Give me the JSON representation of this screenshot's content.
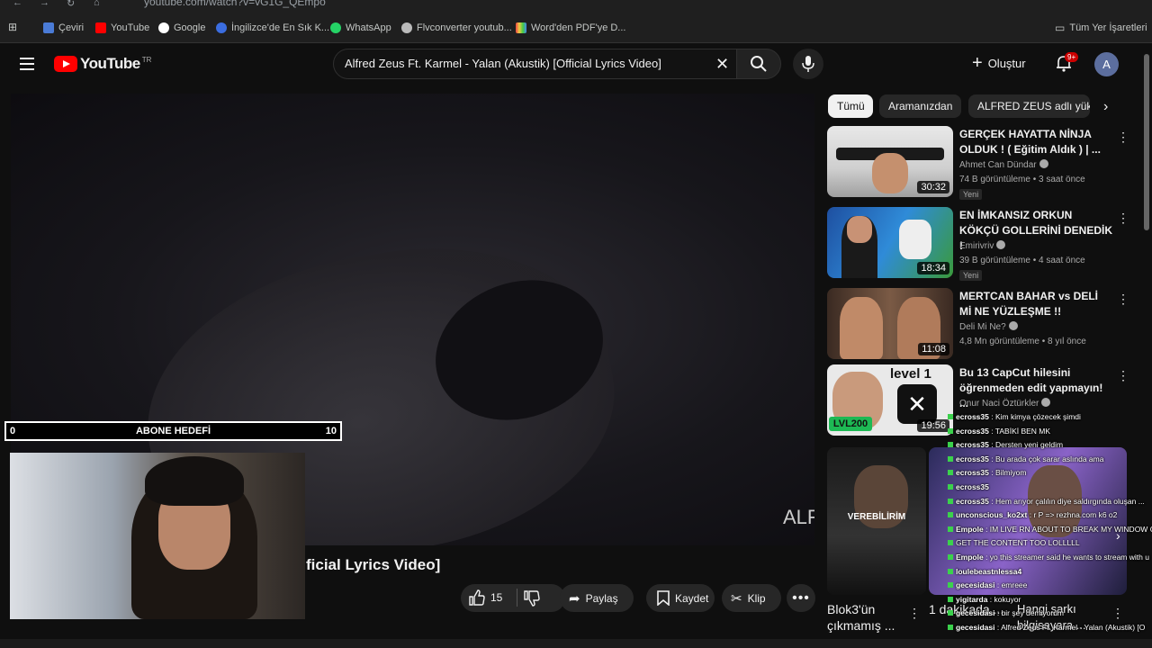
{
  "browser": {
    "url": "youtube.com/watch?v=vG1G_QEmpo",
    "bookmarks": [
      "Çeviri",
      "YouTube",
      "Google",
      "İngilizce'de En Sık K...",
      "WhatsApp",
      "Flvconverter youtub...",
      "Word'den PDF'ye D..."
    ],
    "all_bookmarks": "Tüm Yer İşaretleri"
  },
  "header": {
    "logo": "YouTube",
    "region": "TR",
    "search_value": "Alfred Zeus Ft. Karmel - Yalan (Akustik) [Official Lyrics Video]",
    "create_label": "Oluştur",
    "notifications_badge": "9+",
    "avatar_letter": "A"
  },
  "player": {
    "watermark": "ALF",
    "goal": {
      "min": "0",
      "label": "ABONE HEDEFİ",
      "max": "10"
    },
    "title_visible": "ficial Lyrics Video]"
  },
  "actions": {
    "like_count": "15",
    "share": "Paylaş",
    "save": "Kaydet",
    "clip": "Klip"
  },
  "chips": [
    "Tümü",
    "Aramanızdan",
    "ALFRED ZEUS adlı yükl"
  ],
  "suggestions": [
    {
      "title": "GERÇEK HAYATTA NİNJA OLDUK ! ( Eğitim Aldık ) | ...",
      "channel": "Ahmet Can Dündar",
      "meta": "74 B görüntüleme • 3 saat önce",
      "badge": "Yeni",
      "duration": "30:32"
    },
    {
      "title": "EN İMKANSIZ ORKUN KÖKÇÜ GOLLERİNİ DENEDİK !",
      "channel": "Emirivriv",
      "meta": "39 B görüntüleme • 4 saat önce",
      "badge": "Yeni",
      "duration": "18:34"
    },
    {
      "title": "MERTCAN BAHAR vs DELİ Mİ NE YÜZLEŞME !!",
      "channel": "Deli Mi Ne?",
      "meta": "4,8 Mn görüntüleme • 8 yıl önce",
      "badge": "",
      "duration": "11:08"
    },
    {
      "title": "Bu 13 CapCut hilesini öğrenmeden edit yapmayın! ...",
      "channel": "Onur Naci Öztürkler",
      "meta": "",
      "badge": "",
      "duration": "19:56"
    }
  ],
  "shorts": [
    {
      "title": "Blok3'ün çıkmamış ...",
      "overlay": "VEREBİLİRİM"
    },
    {
      "title": "1 dakikada ...",
      "overlay": ""
    }
  ],
  "shorts_extra": "Hangi şarkı bilgisayara ...",
  "chat": [
    {
      "user": "ecross35",
      "msg": "Kim kimya çözecek şimdi"
    },
    {
      "user": "ecross35",
      "msg": "TABİKİ BEN MK"
    },
    {
      "user": "ecross35",
      "msg": "Dersten yeni geldim"
    },
    {
      "user": "ecross35",
      "msg": "Bu arada çok sarar aslında ama"
    },
    {
      "user": "ecross35",
      "msg": "Bilmiyom"
    },
    {
      "user": "ecross35",
      "msg": ""
    },
    {
      "user": "ecross35",
      "msg": "Hem arıyor çalılın diye saldırgında oluşan ..."
    },
    {
      "user": "unconscious_ko2xt",
      "msg": "r P => rezhna.com k6 o2"
    },
    {
      "user": "Empole",
      "msg": "IM LIVE RN ABOUT TO BREAK MY WINDOW CO"
    },
    {
      "user": "",
      "msg": "GET THE CONTENT TOO LOLLLLL"
    },
    {
      "user": "Empole",
      "msg": "yo this streamer said he wants to stream with u"
    },
    {
      "user": "loulebeastnlessa4",
      "msg": ""
    },
    {
      "user": "gecesidasi",
      "msg": "emreee"
    },
    {
      "user": "yigitarda",
      "msg": "kokuyor"
    },
    {
      "user": "gecesidasi",
      "msg": "bir şey demiyorum"
    },
    {
      "user": "gecesidasi",
      "msg": "Alfred Zeus Ft. Karmel - Yalan (Akustik) [O"
    }
  ],
  "colors": {
    "accent": "#ff0000",
    "background": "#0f0f0f",
    "chip_bg": "#272727",
    "chat_badge": "#3bd14c"
  }
}
